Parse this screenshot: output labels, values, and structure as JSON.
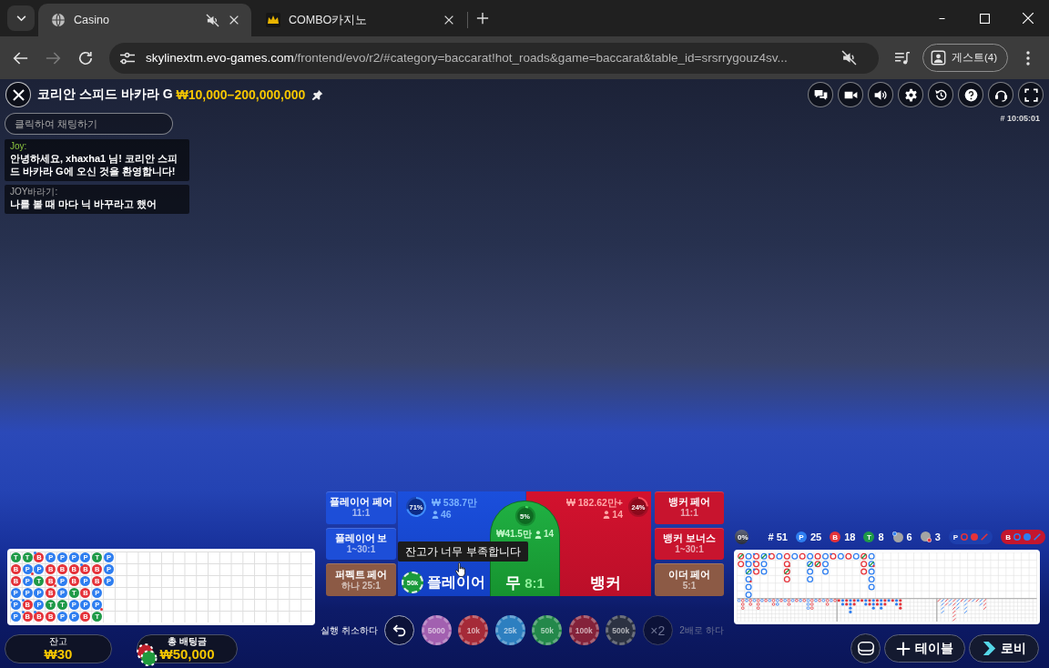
{
  "browser": {
    "tabs": [
      {
        "title": "Casino",
        "kind": "generic",
        "selected": true,
        "muted": true
      },
      {
        "title": "COMBO카지노",
        "kind": "site",
        "selected": false,
        "muted": false
      }
    ],
    "forward_disabled": true,
    "address": {
      "host": "skylinextm.evo-games.com",
      "path": "/frontend/evo/r2/#category=baccarat!hot_roads&game=baccarat&table_id=srsrrygouz4sv...",
      "muted": true
    },
    "profile": "게스트(4)"
  },
  "game": {
    "title": "코리안 스피드 바카라 G",
    "limits": "₩10,000–200,000,000",
    "round_id": "# 10:05:01",
    "chat": {
      "placeholder": "클릭하여 채팅하기",
      "messages": [
        {
          "kind": "host",
          "author": "Joy:",
          "text": "안녕하세요, xhaxha1 님! 코리안 스피드 바카라 G에 오신 것을 환영합니다!"
        },
        {
          "kind": "player",
          "author": "JOY바라기:",
          "text": "나를 볼 때 마다 닉 바꾸라고 했어"
        }
      ]
    }
  },
  "bets": {
    "left": [
      {
        "label": "플레이어 페어",
        "odds": "11:1",
        "color": "#1d4ed8"
      },
      {
        "label": "플레이어 보",
        "odds": "1~30:1",
        "color": "#1d4ed8"
      },
      {
        "label": "퍼펙트 페어",
        "odds": "하나 25:1",
        "color": "#8c5a45"
      }
    ],
    "main": [
      {
        "kind": "player",
        "label": "플레이어",
        "percent": "71%",
        "amount": "₩ 538.7만",
        "players": "46",
        "chip": "50k"
      },
      {
        "kind": "tie",
        "label": "무",
        "odds": "8:1",
        "percent": "5%",
        "amount": "₩41.5만",
        "players": "14"
      },
      {
        "kind": "banker",
        "label": "뱅커",
        "percent": "24%",
        "amount": "₩ 182.62만+",
        "players": "14"
      }
    ],
    "right": [
      {
        "label": "뱅커 페어",
        "odds": "11:1",
        "color": "#c8142e"
      },
      {
        "label": "뱅커 보너스",
        "odds": "1~30:1",
        "color": "#c8142e"
      },
      {
        "label": "이더 페어",
        "odds": "5:1",
        "color": "#8c5a45"
      }
    ],
    "tooltip": "잔고가 너무 부족합니다"
  },
  "chips": {
    "undo": {
      "label": "실행 취소하다",
      "disabled": false
    },
    "values": [
      {
        "label": "5000",
        "color": "#a260b0",
        "disabled": true
      },
      {
        "label": "10k",
        "color": "#a52a38",
        "disabled": true
      },
      {
        "label": "25k",
        "color": "#2d7fc0",
        "disabled": true
      },
      {
        "label": "50k",
        "color": "#23884a",
        "disabled": true
      },
      {
        "label": "100k",
        "color": "#84223a",
        "disabled": true
      },
      {
        "label": "500k",
        "color": "#2c3242",
        "disabled": true
      }
    ],
    "double": {
      "sign": "×2",
      "label": "2배로 하다",
      "disabled": true
    }
  },
  "balance": {
    "label": "잔고",
    "value": "₩30"
  },
  "total_bet": {
    "label": "총 배팅금",
    "value": "₩50,000"
  },
  "bead_road": [
    [
      {
        "kind": "tie",
        "letter": "T",
        "player_pair": false,
        "banker_pair": false
      },
      {
        "kind": "banker",
        "letter": "B",
        "player_pair": false,
        "banker_pair": false
      },
      {
        "kind": "banker",
        "letter": "B",
        "player_pair": false,
        "banker_pair": false
      },
      {
        "kind": "player",
        "letter": "P",
        "player_pair": false,
        "banker_pair": false
      },
      {
        "kind": "player",
        "letter": "P",
        "player_pair": true,
        "banker_pair": false
      },
      {
        "kind": "player",
        "letter": "P",
        "player_pair": false,
        "banker_pair": false
      }
    ],
    [
      {
        "kind": "tie",
        "letter": "T",
        "player_pair": false,
        "banker_pair": false
      },
      {
        "kind": "player",
        "letter": "P",
        "player_pair": false,
        "banker_pair": true
      },
      {
        "kind": "player",
        "letter": "P",
        "player_pair": false,
        "banker_pair": false
      },
      {
        "kind": "player",
        "letter": "P",
        "player_pair": false,
        "banker_pair": false
      },
      {
        "kind": "banker",
        "letter": "B",
        "player_pair": true,
        "banker_pair": false
      },
      {
        "kind": "banker",
        "letter": "B",
        "player_pair": true,
        "banker_pair": false
      }
    ],
    [
      {
        "kind": "banker",
        "letter": "B",
        "player_pair": true,
        "banker_pair": false
      },
      {
        "kind": "player",
        "letter": "P",
        "player_pair": false,
        "banker_pair": false
      },
      {
        "kind": "tie",
        "letter": "T",
        "player_pair": false,
        "banker_pair": false
      },
      {
        "kind": "player",
        "letter": "P",
        "player_pair": false,
        "banker_pair": false
      },
      {
        "kind": "player",
        "letter": "P",
        "player_pair": false,
        "banker_pair": false
      },
      {
        "kind": "banker",
        "letter": "B",
        "player_pair": true,
        "banker_pair": false
      }
    ],
    [
      {
        "kind": "player",
        "letter": "P",
        "player_pair": false,
        "banker_pair": false
      },
      {
        "kind": "banker",
        "letter": "B",
        "player_pair": false,
        "banker_pair": false
      },
      {
        "kind": "banker",
        "letter": "B",
        "player_pair": false,
        "banker_pair": true
      },
      {
        "kind": "banker",
        "letter": "B",
        "player_pair": false,
        "banker_pair": false
      },
      {
        "kind": "tie",
        "letter": "T",
        "player_pair": false,
        "banker_pair": false
      },
      {
        "kind": "banker",
        "letter": "B",
        "player_pair": false,
        "banker_pair": false
      }
    ],
    [
      {
        "kind": "player",
        "letter": "P",
        "player_pair": false,
        "banker_pair": false
      },
      {
        "kind": "banker",
        "letter": "B",
        "player_pair": false,
        "banker_pair": false
      },
      {
        "kind": "player",
        "letter": "P",
        "player_pair": false,
        "banker_pair": false
      },
      {
        "kind": "player",
        "letter": "P",
        "player_pair": false,
        "banker_pair": false
      },
      {
        "kind": "tie",
        "letter": "T",
        "player_pair": false,
        "banker_pair": false
      },
      {
        "kind": "player",
        "letter": "P",
        "player_pair": false,
        "banker_pair": false
      }
    ],
    [
      {
        "kind": "player",
        "letter": "P",
        "player_pair": false,
        "banker_pair": false
      },
      {
        "kind": "banker",
        "letter": "B",
        "player_pair": false,
        "banker_pair": false
      },
      {
        "kind": "banker",
        "letter": "B",
        "player_pair": false,
        "banker_pair": false
      },
      {
        "kind": "tie",
        "letter": "T",
        "player_pair": false,
        "banker_pair": false
      },
      {
        "kind": "player",
        "letter": "P",
        "player_pair": false,
        "banker_pair": false
      },
      {
        "kind": "player",
        "letter": "P",
        "player_pair": false,
        "banker_pair": false
      }
    ],
    [
      {
        "kind": "player",
        "letter": "P",
        "player_pair": false,
        "banker_pair": false
      },
      {
        "kind": "banker",
        "letter": "B",
        "player_pair": true,
        "banker_pair": false
      },
      {
        "kind": "player",
        "letter": "P",
        "player_pair": false,
        "banker_pair": false
      },
      {
        "kind": "banker",
        "letter": "B",
        "player_pair": false,
        "banker_pair": false
      },
      {
        "kind": "player",
        "letter": "P",
        "player_pair": false,
        "banker_pair": false
      },
      {
        "kind": "banker",
        "letter": "B",
        "player_pair": false,
        "banker_pair": false
      }
    ],
    [
      {
        "kind": "tie",
        "letter": "T",
        "player_pair": false,
        "banker_pair": false
      },
      {
        "kind": "banker",
        "letter": "B",
        "player_pair": false,
        "banker_pair": false
      },
      {
        "kind": "banker",
        "letter": "B",
        "player_pair": false,
        "banker_pair": false
      },
      {
        "kind": "player",
        "letter": "P",
        "player_pair": false,
        "banker_pair": false
      },
      {
        "kind": "player",
        "letter": "P",
        "player_pair": false,
        "banker_pair": true
      },
      {
        "kind": "tie",
        "letter": "T",
        "player_pair": false,
        "banker_pair": false
      }
    ],
    [
      {
        "kind": "player",
        "letter": "P",
        "player_pair": false,
        "banker_pair": false
      },
      {
        "kind": "player",
        "letter": "P",
        "player_pair": false,
        "banker_pair": false
      },
      {
        "kind": "player",
        "letter": "P",
        "player_pair": false,
        "banker_pair": false
      }
    ]
  ],
  "stats": {
    "toggle": "0%",
    "total": "# 51",
    "items": [
      {
        "kind": "player",
        "letter": "P",
        "count": "25"
      },
      {
        "kind": "banker",
        "letter": "B",
        "count": "18"
      },
      {
        "kind": "tie",
        "letter": "T",
        "count": "8"
      },
      {
        "kind": "player_pair",
        "count": "6"
      },
      {
        "kind": "banker_pair",
        "count": "3"
      }
    ],
    "predictions": [
      {
        "kind": "player",
        "letter": "P",
        "color": "#e5333a"
      },
      {
        "kind": "banker",
        "letter": "B",
        "color": "#2e7ef0"
      }
    ]
  },
  "actions": [
    {
      "kind": "table_view"
    },
    {
      "kind": "add_table",
      "label": "테이블"
    },
    {
      "kind": "lobby",
      "label": "로비"
    }
  ]
}
